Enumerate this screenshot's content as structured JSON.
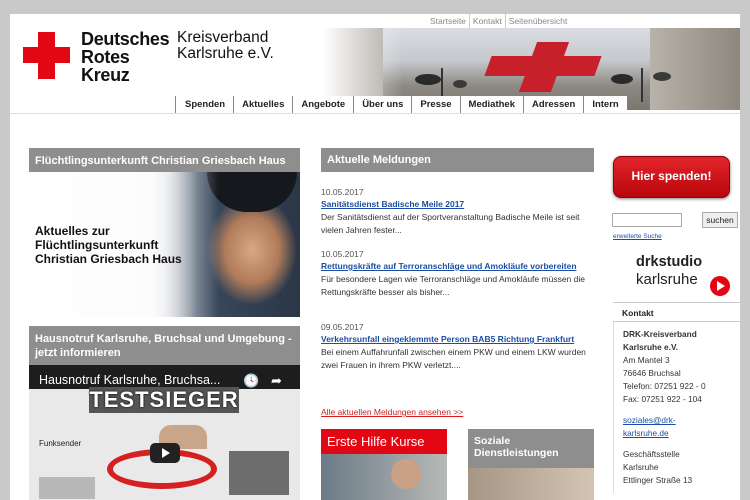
{
  "header": {
    "logo_lines": [
      "Deutsches",
      "Rotes",
      "Kreuz"
    ],
    "subtitle_lines": [
      "Kreisverband",
      "Karlsruhe e.V."
    ],
    "top_links": [
      "Startseite",
      "Kontakt",
      "Seitenübersicht"
    ],
    "nav": [
      "Spenden",
      "Aktuelles",
      "Angebote",
      "Über uns",
      "Presse",
      "Mediathek",
      "Adressen",
      "Intern"
    ]
  },
  "left": {
    "box1_title": "Flüchtlingsunterkunft Christian Griesbach Haus",
    "promo_lines": [
      "Aktuelles zur",
      "Flüchtlingsunterkunft",
      "Christian Griesbach Haus"
    ],
    "box2_title": "Hausnotruf Karlsruhe, Bruchsal und Umgebung - jetzt informieren",
    "video": {
      "title": "Hausnotruf Karlsruhe, Bruchsa...",
      "badge": "TESTSIEGER",
      "label": "Funksender"
    }
  },
  "middle": {
    "title": "Aktuelle Meldungen",
    "news": [
      {
        "date": "10.05.2017",
        "title": "Sanitätsdienst Badische Meile 2017",
        "text": "Der Sanitätsdienst auf der Sportveranstaltung Badische Meile ist seit vielen Jahren fester..."
      },
      {
        "date": "10.05.2017",
        "title": "Rettungskräfte auf Terroranschläge und Amokläufe vorbereiten",
        "text": "Für besondere Lagen wie Terroranschläge und Amokläufe müssen die Rettungskräfte besser als bisher..."
      },
      {
        "date": "09.05.2017",
        "title": "Verkehrsunfall eingeklemmte Person BAB5 Richtung Frankfurt",
        "text": "Bei einem Auffahrunfall zwischen einem PKW und einem LKW wurden zwei Frauen in ihrem PKW verletzt...."
      }
    ],
    "all_news": "Alle aktuellen Meldungen ansehen >>",
    "tile1": "Erste Hilfe Kurse",
    "tile2_lines": [
      "Soziale",
      "Dienstleistungen"
    ]
  },
  "right": {
    "donate": "Hier spenden!",
    "search_button": "suchen",
    "search_value": "",
    "advanced_search": "erweiterte Suche",
    "studio_lines": [
      "drkstudio",
      "karlsruhe"
    ],
    "contact_title": "Kontakt",
    "contact": {
      "org1": "DRK-Kreisverband",
      "org2": "Karlsruhe e.V.",
      "street": "Am Mantel 3",
      "city": "76646 Bruchsal",
      "phone": "Telefon: 07251 922 - 0",
      "fax": "Fax: 07251 922 - 104",
      "email1": "soziales@drk-",
      "email2": "karlsruhe.de",
      "office": "Geschäftsstelle",
      "office_city": "Karlsruhe",
      "office_street": "Ettlinger Straße 13"
    }
  },
  "colors": {
    "drk_red": "#e30613",
    "header_grey": "#8e8e8e",
    "link_blue": "#1a4ea6",
    "background": "#c9c9c9"
  }
}
